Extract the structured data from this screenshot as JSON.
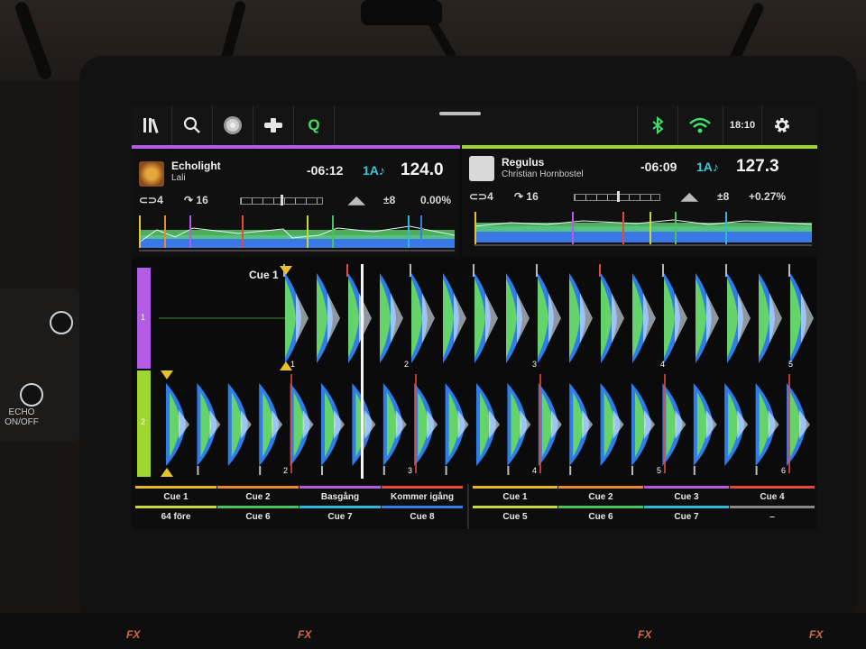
{
  "topbar": {
    "icons": [
      "library-icon",
      "search-icon",
      "vinyl-icon",
      "crossfader-icon",
      "quantize-icon",
      "bluetooth-icon",
      "wifi-icon",
      "settings-icon"
    ],
    "quantize_label": "Q",
    "time": "18:10"
  },
  "deck1": {
    "title": "Echolight",
    "artist": "Lali",
    "time_remaining": "-06:12",
    "key": "1A",
    "bpm": "124.0",
    "loop": "4",
    "beatjump": "16",
    "range": "±8",
    "pitch": "0.00%",
    "number": "1",
    "color": "#b55ce6"
  },
  "deck2": {
    "title": "Regulus",
    "artist": "Christian Hornbostel",
    "time_remaining": "-06:09",
    "key": "1A",
    "bpm": "127.3",
    "loop": "4",
    "beatjump": "16",
    "range": "±8",
    "pitch": "+0.27%",
    "number": "2",
    "color": "#9fd72f"
  },
  "waveform": {
    "cue_label": "Cue 1",
    "deck1_bar_numbers": [
      "1",
      "2",
      "3",
      "4",
      "5"
    ],
    "deck2_bar_numbers": [
      "2",
      "3",
      "4",
      "5",
      "6"
    ]
  },
  "hotcues_left": [
    {
      "label": "Cue 1",
      "color": "#e5b42a"
    },
    {
      "label": "Cue 2",
      "color": "#e98a2d"
    },
    {
      "label": "Basgång",
      "color": "#b55ce6"
    },
    {
      "label": "Kommer igång",
      "color": "#e84a3a"
    },
    {
      "label": "64 före",
      "color": "#c7d83a"
    },
    {
      "label": "Cue 6",
      "color": "#47c55a"
    },
    {
      "label": "Cue 7",
      "color": "#2fb8d8"
    },
    {
      "label": "Cue 8",
      "color": "#3b7de6"
    }
  ],
  "hotcues_right": [
    {
      "label": "Cue 1",
      "color": "#e5b42a"
    },
    {
      "label": "Cue 2",
      "color": "#e98a2d"
    },
    {
      "label": "Cue 3",
      "color": "#b55ce6"
    },
    {
      "label": "Cue 4",
      "color": "#e84a3a"
    },
    {
      "label": "Cue 5",
      "color": "#c7d83a"
    },
    {
      "label": "Cue 6",
      "color": "#47c55a"
    },
    {
      "label": "Cue 7",
      "color": "#2fb8d8"
    },
    {
      "label": "–",
      "color": "#888888"
    }
  ],
  "hardware": {
    "echo_label": "ECHO\nON/OFF",
    "fx_labels": [
      "FX",
      "FX",
      "FX",
      "FX"
    ]
  }
}
